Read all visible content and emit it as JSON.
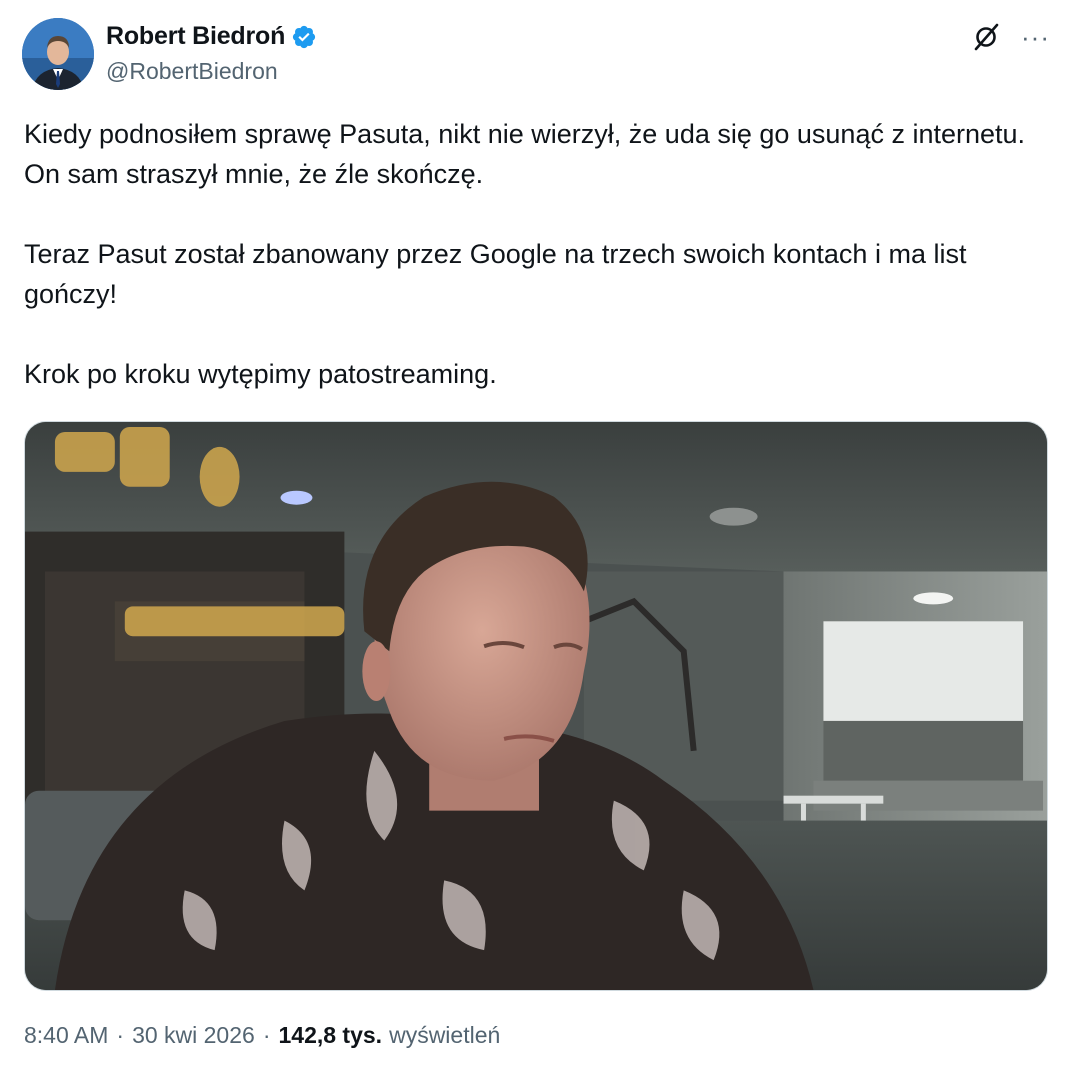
{
  "author": {
    "display_name": "Robert Biedroń",
    "handle": "@RobertBiedron",
    "verified": true
  },
  "icons": {
    "verified": "verified-badge-icon",
    "grok": "grok-icon",
    "more": "more-options-icon"
  },
  "tweet": {
    "paragraphs": [
      "Kiedy podnosiłem sprawę Pasuta, nikt nie wierzył, że uda się go usunąć z internetu. On sam straszył mnie, że źle skończę.",
      "Teraz Pasut został zbanowany przez Google na trzech swoich kontach i ma list gończy!",
      "Krok po kroku wytępimy patostreaming."
    ]
  },
  "meta": {
    "time": "8:40 AM",
    "separator": "·",
    "date": "30 kwi 2026",
    "views_count": "142,8 tys.",
    "views_label": "wyświetleń"
  },
  "colors": {
    "text_primary": "#0f1419",
    "text_secondary": "#536471",
    "verified_blue": "#1d9bf0",
    "border": "#cfd9de"
  }
}
